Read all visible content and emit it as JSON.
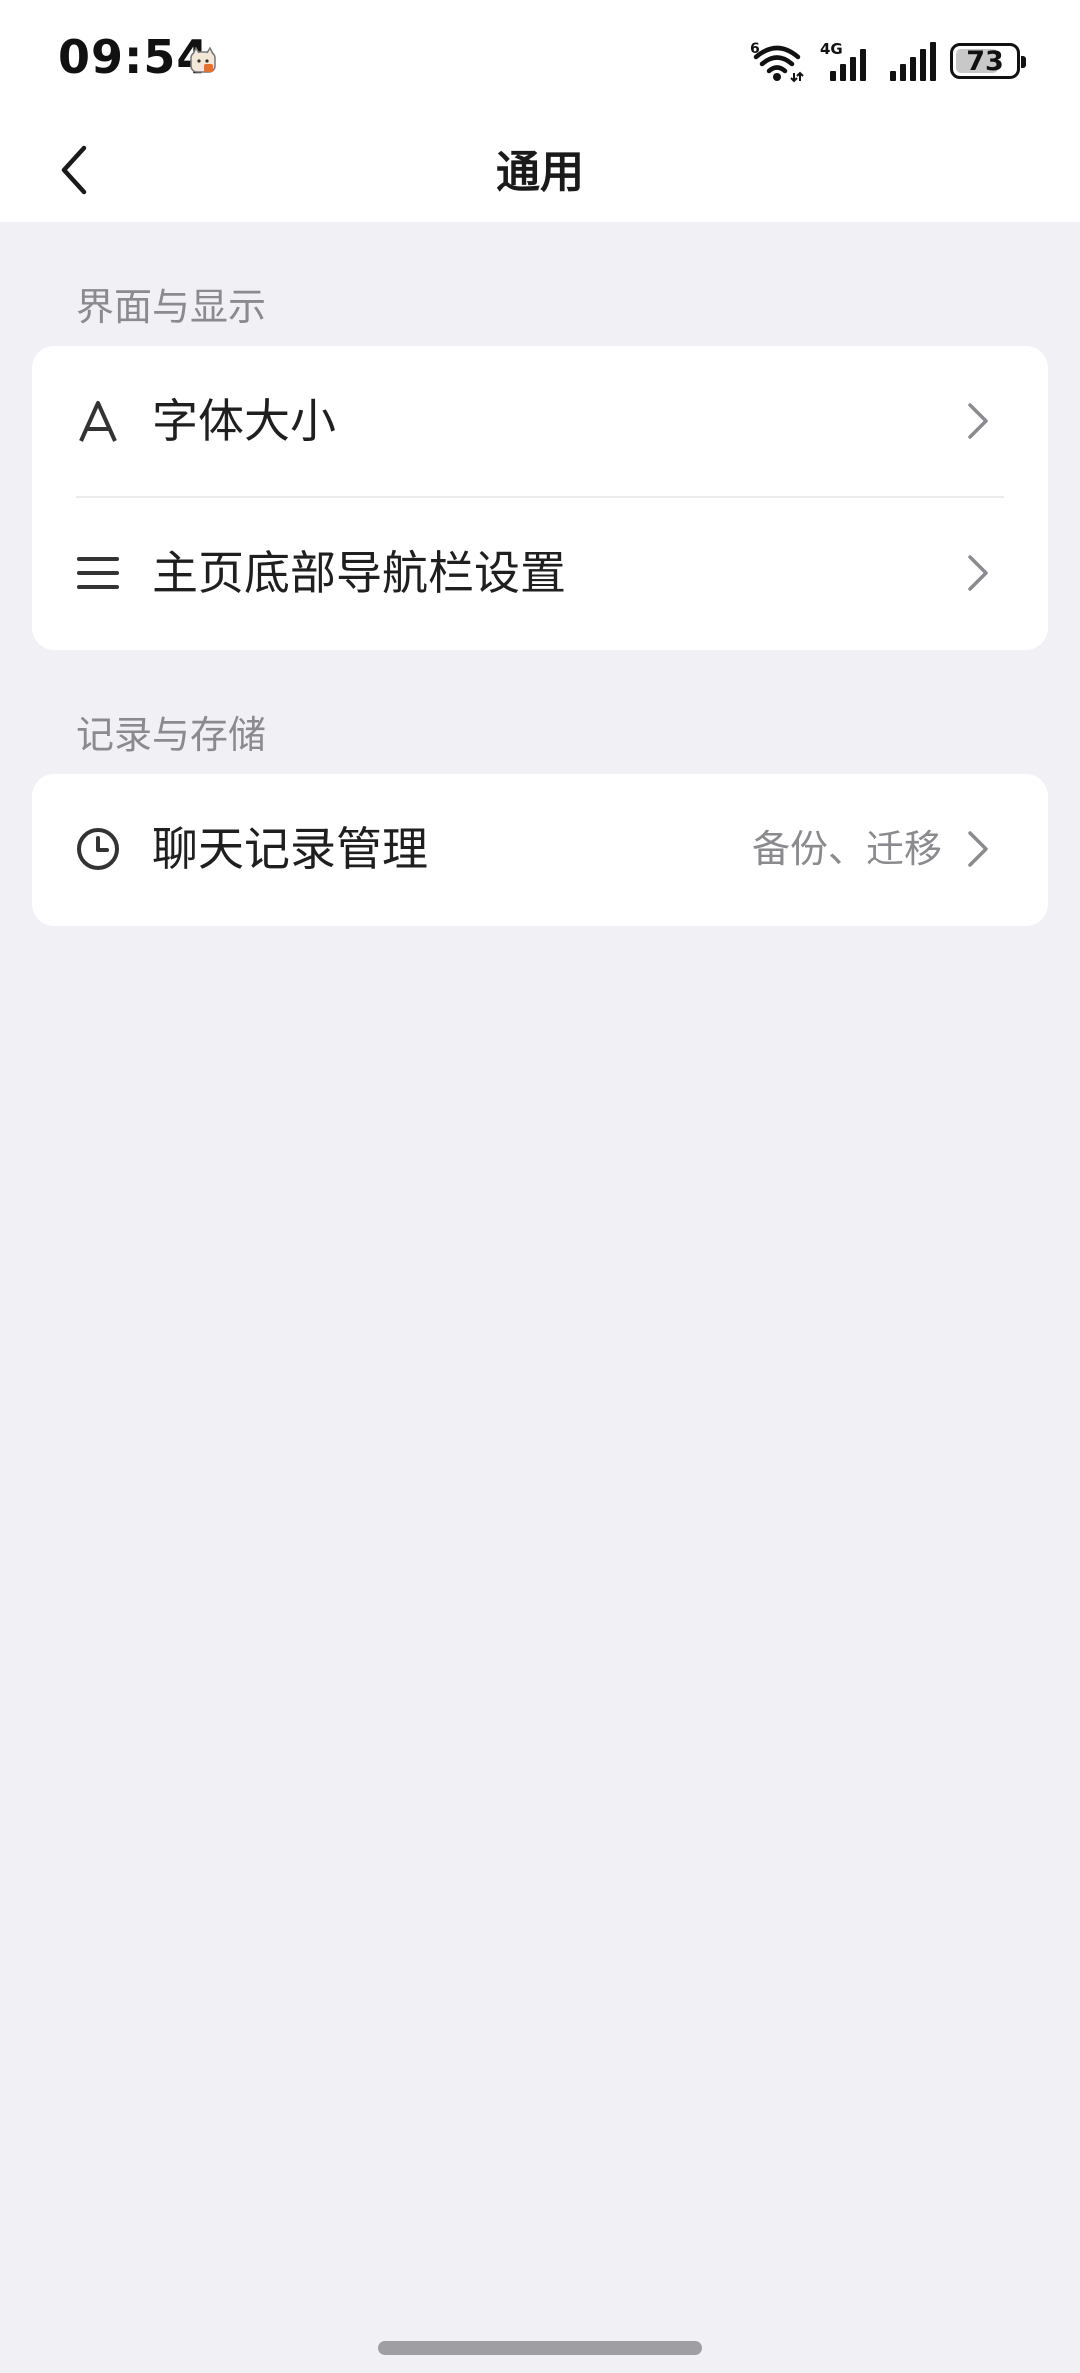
{
  "status_bar": {
    "time": "09:54",
    "app_icon": "cat-notification-icon",
    "icons": [
      "wifi-icon",
      "cellular-4g-icon",
      "cellular-signal-icon"
    ],
    "wifi_label": "6",
    "network_label": "4G",
    "battery_level": "73",
    "battery_fraction": 0.73
  },
  "nav": {
    "back_icon": "chevron-left-icon",
    "title": "通用"
  },
  "sections": [
    {
      "header": "界面与显示",
      "items": [
        {
          "icon": "font-a-icon",
          "label": "字体大小",
          "value": ""
        },
        {
          "icon": "menu-lines-icon",
          "label": "主页底部导航栏设置",
          "value": ""
        }
      ]
    },
    {
      "header": "记录与存储",
      "items": [
        {
          "icon": "clock-icon",
          "label": "聊天记录管理",
          "value": "备份、迁移"
        }
      ]
    }
  ],
  "colors": {
    "background": "#f1f0f5",
    "card": "#ffffff",
    "secondary_text": "#8a8a8f",
    "primary_text": "#1f1f1f"
  }
}
